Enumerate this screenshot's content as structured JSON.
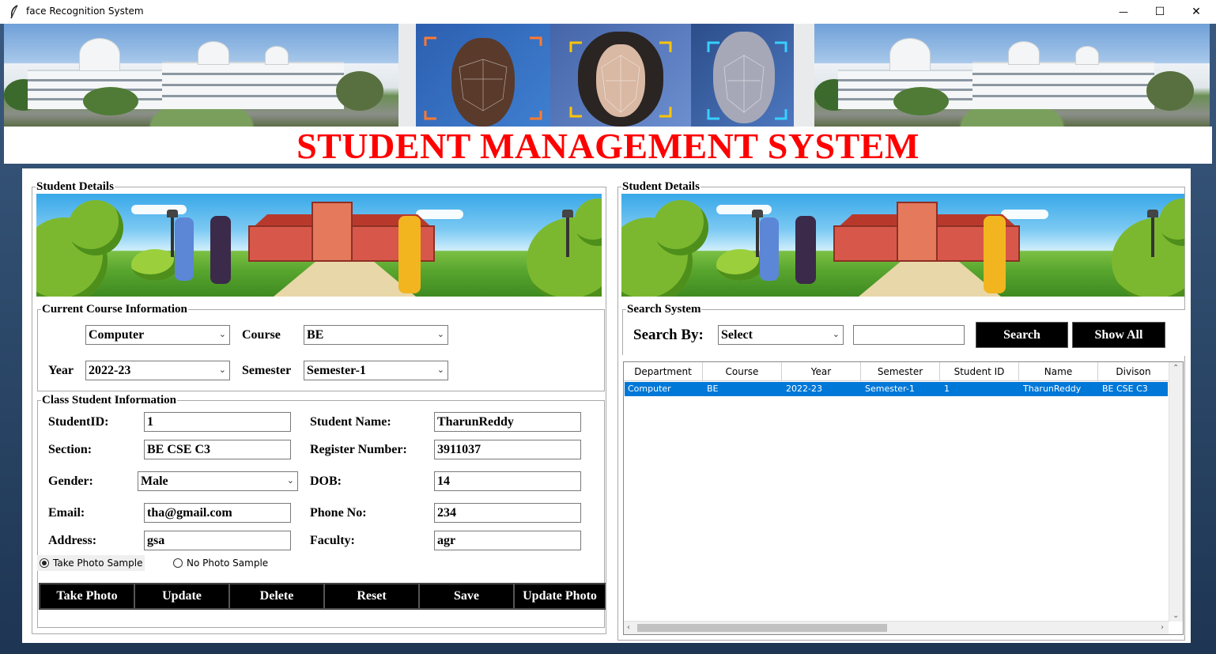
{
  "window": {
    "title": "face Recognition System",
    "minimize": "—",
    "maximize": "☐",
    "close": "✕"
  },
  "header": {
    "title": "STUDENT MANAGEMENT SYSTEM"
  },
  "left": {
    "legend": "Student Details",
    "course_group": {
      "legend": "Current Course Information",
      "department_value": "Computer",
      "course_label": "Course",
      "course_value": "BE",
      "year_label": "Year",
      "year_value": "2022-23",
      "semester_label": "Semester",
      "semester_value": "Semester-1"
    },
    "class_group": {
      "legend": "Class Student Information",
      "student_id_label": "StudentID:",
      "student_id_value": "1",
      "student_name_label": "Student Name:",
      "student_name_value": "TharunReddy",
      "section_label": "Section:",
      "section_value": "BE CSE C3",
      "register_label": "Register Number:",
      "register_value": "3911037",
      "gender_label": "Gender:",
      "gender_value": "Male",
      "dob_label": "DOB:",
      "dob_value": "14",
      "email_label": "Email:",
      "email_value": "tha@gmail.com",
      "phone_label": "Phone No:",
      "phone_value": "234",
      "address_label": "Address:",
      "address_value": "gsa",
      "faculty_label": "Faculty:",
      "faculty_value": "agr",
      "radio_take": "Take Photo Sample",
      "radio_no": "No Photo Sample"
    },
    "buttons": {
      "take_photo": "Take Photo",
      "update": "Update",
      "delete": "Delete",
      "reset": "Reset",
      "save": "Save",
      "update_photo": "Update Photo"
    }
  },
  "right": {
    "legend": "Student Details",
    "search": {
      "legend": "Search System",
      "label": "Search By:",
      "select_value": "Select",
      "input_value": "",
      "search_btn": "Search",
      "show_all_btn": "Show All"
    },
    "table": {
      "columns": [
        "Department",
        "Course",
        "Year",
        "Semester",
        "Student ID",
        "Name",
        "Divison"
      ],
      "rows": [
        [
          "Computer",
          "BE",
          "2022-23",
          "Semester-1",
          "1",
          "TharunReddy",
          "BE CSE C3"
        ]
      ]
    }
  },
  "colors": {
    "title_red": "#ff0000",
    "selection_blue": "#0078d7",
    "button_black": "#000000"
  }
}
